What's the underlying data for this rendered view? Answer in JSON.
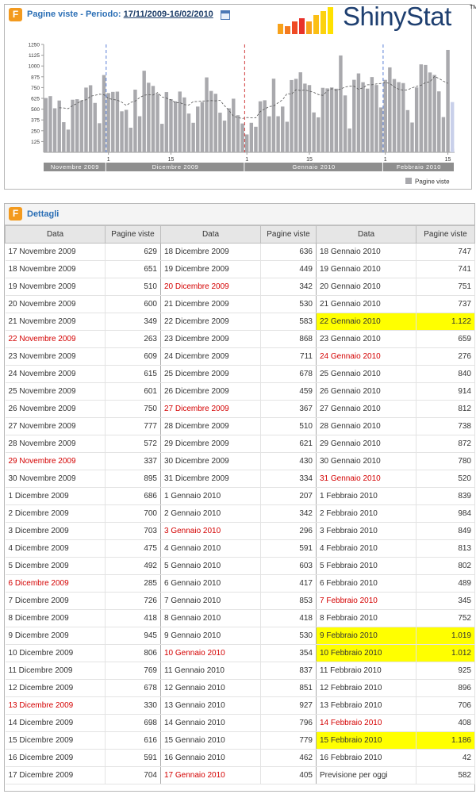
{
  "chart_panel": {
    "title_prefix": "Pagine viste - Periodo: ",
    "period": "17/11/2009-16/02/2010",
    "legend_label": "Pagine viste"
  },
  "logo": {
    "text": "ShinyStat",
    "tm": "TM"
  },
  "details_panel": {
    "title": "Dettagli",
    "col_data": "Data",
    "col_views": "Pagine viste",
    "columns": [
      [
        {
          "date": "17 Novembre 2009",
          "value": "629"
        },
        {
          "date": "18 Novembre 2009",
          "value": "651"
        },
        {
          "date": "19 Novembre 2009",
          "value": "510"
        },
        {
          "date": "20 Novembre 2009",
          "value": "600"
        },
        {
          "date": "21 Novembre 2009",
          "value": "349"
        },
        {
          "date": "22 Novembre 2009",
          "value": "263",
          "holiday": true
        },
        {
          "date": "23 Novembre 2009",
          "value": "609"
        },
        {
          "date": "24 Novembre 2009",
          "value": "615"
        },
        {
          "date": "25 Novembre 2009",
          "value": "601"
        },
        {
          "date": "26 Novembre 2009",
          "value": "750"
        },
        {
          "date": "27 Novembre 2009",
          "value": "777"
        },
        {
          "date": "28 Novembre 2009",
          "value": "572"
        },
        {
          "date": "29 Novembre 2009",
          "value": "337",
          "holiday": true
        },
        {
          "date": "30 Novembre 2009",
          "value": "895"
        },
        {
          "date": "1 Dicembre 2009",
          "value": "686"
        },
        {
          "date": "2 Dicembre 2009",
          "value": "700"
        },
        {
          "date": "3 Dicembre 2009",
          "value": "703"
        },
        {
          "date": "4 Dicembre 2009",
          "value": "475"
        },
        {
          "date": "5 Dicembre 2009",
          "value": "492"
        },
        {
          "date": "6 Dicembre 2009",
          "value": "285",
          "holiday": true
        },
        {
          "date": "7 Dicembre 2009",
          "value": "726"
        },
        {
          "date": "8 Dicembre 2009",
          "value": "418"
        },
        {
          "date": "9 Dicembre 2009",
          "value": "945"
        },
        {
          "date": "10 Dicembre 2009",
          "value": "806"
        },
        {
          "date": "11 Dicembre 2009",
          "value": "769"
        },
        {
          "date": "12 Dicembre 2009",
          "value": "678"
        },
        {
          "date": "13 Dicembre 2009",
          "value": "330",
          "holiday": true
        },
        {
          "date": "14 Dicembre 2009",
          "value": "698"
        },
        {
          "date": "15 Dicembre 2009",
          "value": "616"
        },
        {
          "date": "16 Dicembre 2009",
          "value": "591"
        },
        {
          "date": "17 Dicembre 2009",
          "value": "704"
        }
      ],
      [
        {
          "date": "18 Dicembre 2009",
          "value": "636"
        },
        {
          "date": "19 Dicembre 2009",
          "value": "449"
        },
        {
          "date": "20 Dicembre 2009",
          "value": "342",
          "holiday": true
        },
        {
          "date": "21 Dicembre 2009",
          "value": "530"
        },
        {
          "date": "22 Dicembre 2009",
          "value": "583"
        },
        {
          "date": "23 Dicembre 2009",
          "value": "868"
        },
        {
          "date": "24 Dicembre 2009",
          "value": "711"
        },
        {
          "date": "25 Dicembre 2009",
          "value": "678"
        },
        {
          "date": "26 Dicembre 2009",
          "value": "459"
        },
        {
          "date": "27 Dicembre 2009",
          "value": "367",
          "holiday": true
        },
        {
          "date": "28 Dicembre 2009",
          "value": "510"
        },
        {
          "date": "29 Dicembre 2009",
          "value": "621"
        },
        {
          "date": "30 Dicembre 2009",
          "value": "430"
        },
        {
          "date": "31 Dicembre 2009",
          "value": "334"
        },
        {
          "date": "1 Gennaio 2010",
          "value": "207"
        },
        {
          "date": "2 Gennaio 2010",
          "value": "342"
        },
        {
          "date": "3 Gennaio 2010",
          "value": "296",
          "holiday": true
        },
        {
          "date": "4 Gennaio 2010",
          "value": "591"
        },
        {
          "date": "5 Gennaio 2010",
          "value": "603"
        },
        {
          "date": "6 Gennaio 2010",
          "value": "417"
        },
        {
          "date": "7 Gennaio 2010",
          "value": "853"
        },
        {
          "date": "8 Gennaio 2010",
          "value": "418"
        },
        {
          "date": "9 Gennaio 2010",
          "value": "530"
        },
        {
          "date": "10 Gennaio 2010",
          "value": "354",
          "holiday": true
        },
        {
          "date": "11 Gennaio 2010",
          "value": "837"
        },
        {
          "date": "12 Gennaio 2010",
          "value": "851"
        },
        {
          "date": "13 Gennaio 2010",
          "value": "927"
        },
        {
          "date": "14 Gennaio 2010",
          "value": "796"
        },
        {
          "date": "15 Gennaio 2010",
          "value": "779"
        },
        {
          "date": "16 Gennaio 2010",
          "value": "462"
        },
        {
          "date": "17 Gennaio 2010",
          "value": "405",
          "holiday": true
        }
      ],
      [
        {
          "date": "18 Gennaio 2010",
          "value": "747"
        },
        {
          "date": "19 Gennaio 2010",
          "value": "741"
        },
        {
          "date": "20 Gennaio 2010",
          "value": "751"
        },
        {
          "date": "21 Gennaio 2010",
          "value": "737"
        },
        {
          "date": "22 Gennaio 2010",
          "value": "1.122",
          "highlight": true
        },
        {
          "date": "23 Gennaio 2010",
          "value": "659"
        },
        {
          "date": "24 Gennaio 2010",
          "value": "276",
          "holiday": true
        },
        {
          "date": "25 Gennaio 2010",
          "value": "840"
        },
        {
          "date": "26 Gennaio 2010",
          "value": "914"
        },
        {
          "date": "27 Gennaio 2010",
          "value": "812"
        },
        {
          "date": "28 Gennaio 2010",
          "value": "738"
        },
        {
          "date": "29 Gennaio 2010",
          "value": "872"
        },
        {
          "date": "30 Gennaio 2010",
          "value": "780"
        },
        {
          "date": "31 Gennaio 2010",
          "value": "520",
          "holiday": true
        },
        {
          "date": "1 Febbraio 2010",
          "value": "839"
        },
        {
          "date": "2 Febbraio 2010",
          "value": "984"
        },
        {
          "date": "3 Febbraio 2010",
          "value": "849"
        },
        {
          "date": "4 Febbraio 2010",
          "value": "813"
        },
        {
          "date": "5 Febbraio 2010",
          "value": "802"
        },
        {
          "date": "6 Febbraio 2010",
          "value": "489"
        },
        {
          "date": "7 Febbraio 2010",
          "value": "345",
          "holiday": true
        },
        {
          "date": "8 Febbraio 2010",
          "value": "752"
        },
        {
          "date": "9 Febbraio 2010",
          "value": "1.019",
          "highlight": true
        },
        {
          "date": "10 Febbraio 2010",
          "value": "1.012",
          "highlight": true
        },
        {
          "date": "11 Febbraio 2010",
          "value": "925"
        },
        {
          "date": "12 Febbraio 2010",
          "value": "896"
        },
        {
          "date": "13 Febbraio 2010",
          "value": "706"
        },
        {
          "date": "14 Febbraio 2010",
          "value": "408",
          "holiday": true
        },
        {
          "date": "15 Febbraio 2010",
          "value": "1.186",
          "highlight": true
        },
        {
          "date": "16 Febbraio 2010",
          "value": "42"
        },
        {
          "date": "Previsione per oggi",
          "value": "582"
        }
      ]
    ]
  },
  "colors": {
    "title_blue": "#2a6eb5",
    "bar": "#a9a9ad",
    "holiday_red": "#d40000",
    "highlight": "#ffff00",
    "month_band": "#8e8e8e",
    "forecast_bar": "#c9d0ea"
  },
  "chart_data": {
    "type": "bar",
    "title": "Pagine viste - Periodo: 17/11/2009-16/02/2010",
    "ylim": [
      0,
      1250
    ],
    "y_ticks": [
      125,
      250,
      375,
      500,
      625,
      750,
      875,
      1000,
      1125,
      1250
    ],
    "x_ticks": [
      {
        "index": 14,
        "label": "1"
      },
      {
        "index": 28,
        "label": "15"
      },
      {
        "index": 45,
        "label": "1"
      },
      {
        "index": 59,
        "label": "15"
      },
      {
        "index": 76,
        "label": "1"
      },
      {
        "index": 90,
        "label": "15"
      }
    ],
    "months": [
      {
        "label": "Novembre 2009",
        "start": 0,
        "end": 14
      },
      {
        "label": "Dicembre 2009",
        "start": 14,
        "end": 45
      },
      {
        "label": "Gennaio 2010",
        "start": 45,
        "end": 76
      },
      {
        "label": "Febbraio 2010",
        "start": 76,
        "end": 92
      }
    ],
    "month_separators": [
      {
        "index": 14,
        "color": "#5a7fd6"
      },
      {
        "index": 45,
        "color": "#d03a3a"
      },
      {
        "index": 76,
        "color": "#5a7fd6"
      }
    ],
    "series": [
      {
        "name": "Pagine viste",
        "values": [
          629,
          651,
          510,
          600,
          349,
          263,
          609,
          615,
          601,
          750,
          777,
          572,
          337,
          895,
          686,
          700,
          703,
          475,
          492,
          285,
          726,
          418,
          945,
          806,
          769,
          678,
          330,
          698,
          616,
          591,
          704,
          636,
          449,
          342,
          530,
          583,
          868,
          711,
          678,
          459,
          367,
          510,
          621,
          430,
          334,
          207,
          342,
          296,
          591,
          603,
          417,
          853,
          418,
          530,
          354,
          837,
          851,
          927,
          796,
          779,
          462,
          405,
          747,
          741,
          751,
          737,
          1122,
          659,
          276,
          840,
          914,
          812,
          738,
          872,
          780,
          520,
          839,
          984,
          849,
          813,
          802,
          489,
          345,
          752,
          1019,
          1012,
          925,
          896,
          706,
          408,
          1186,
          42
        ]
      }
    ],
    "forecast": {
      "index": 91,
      "value": 582
    },
    "trend_line": true,
    "legend": "bottom-right"
  }
}
